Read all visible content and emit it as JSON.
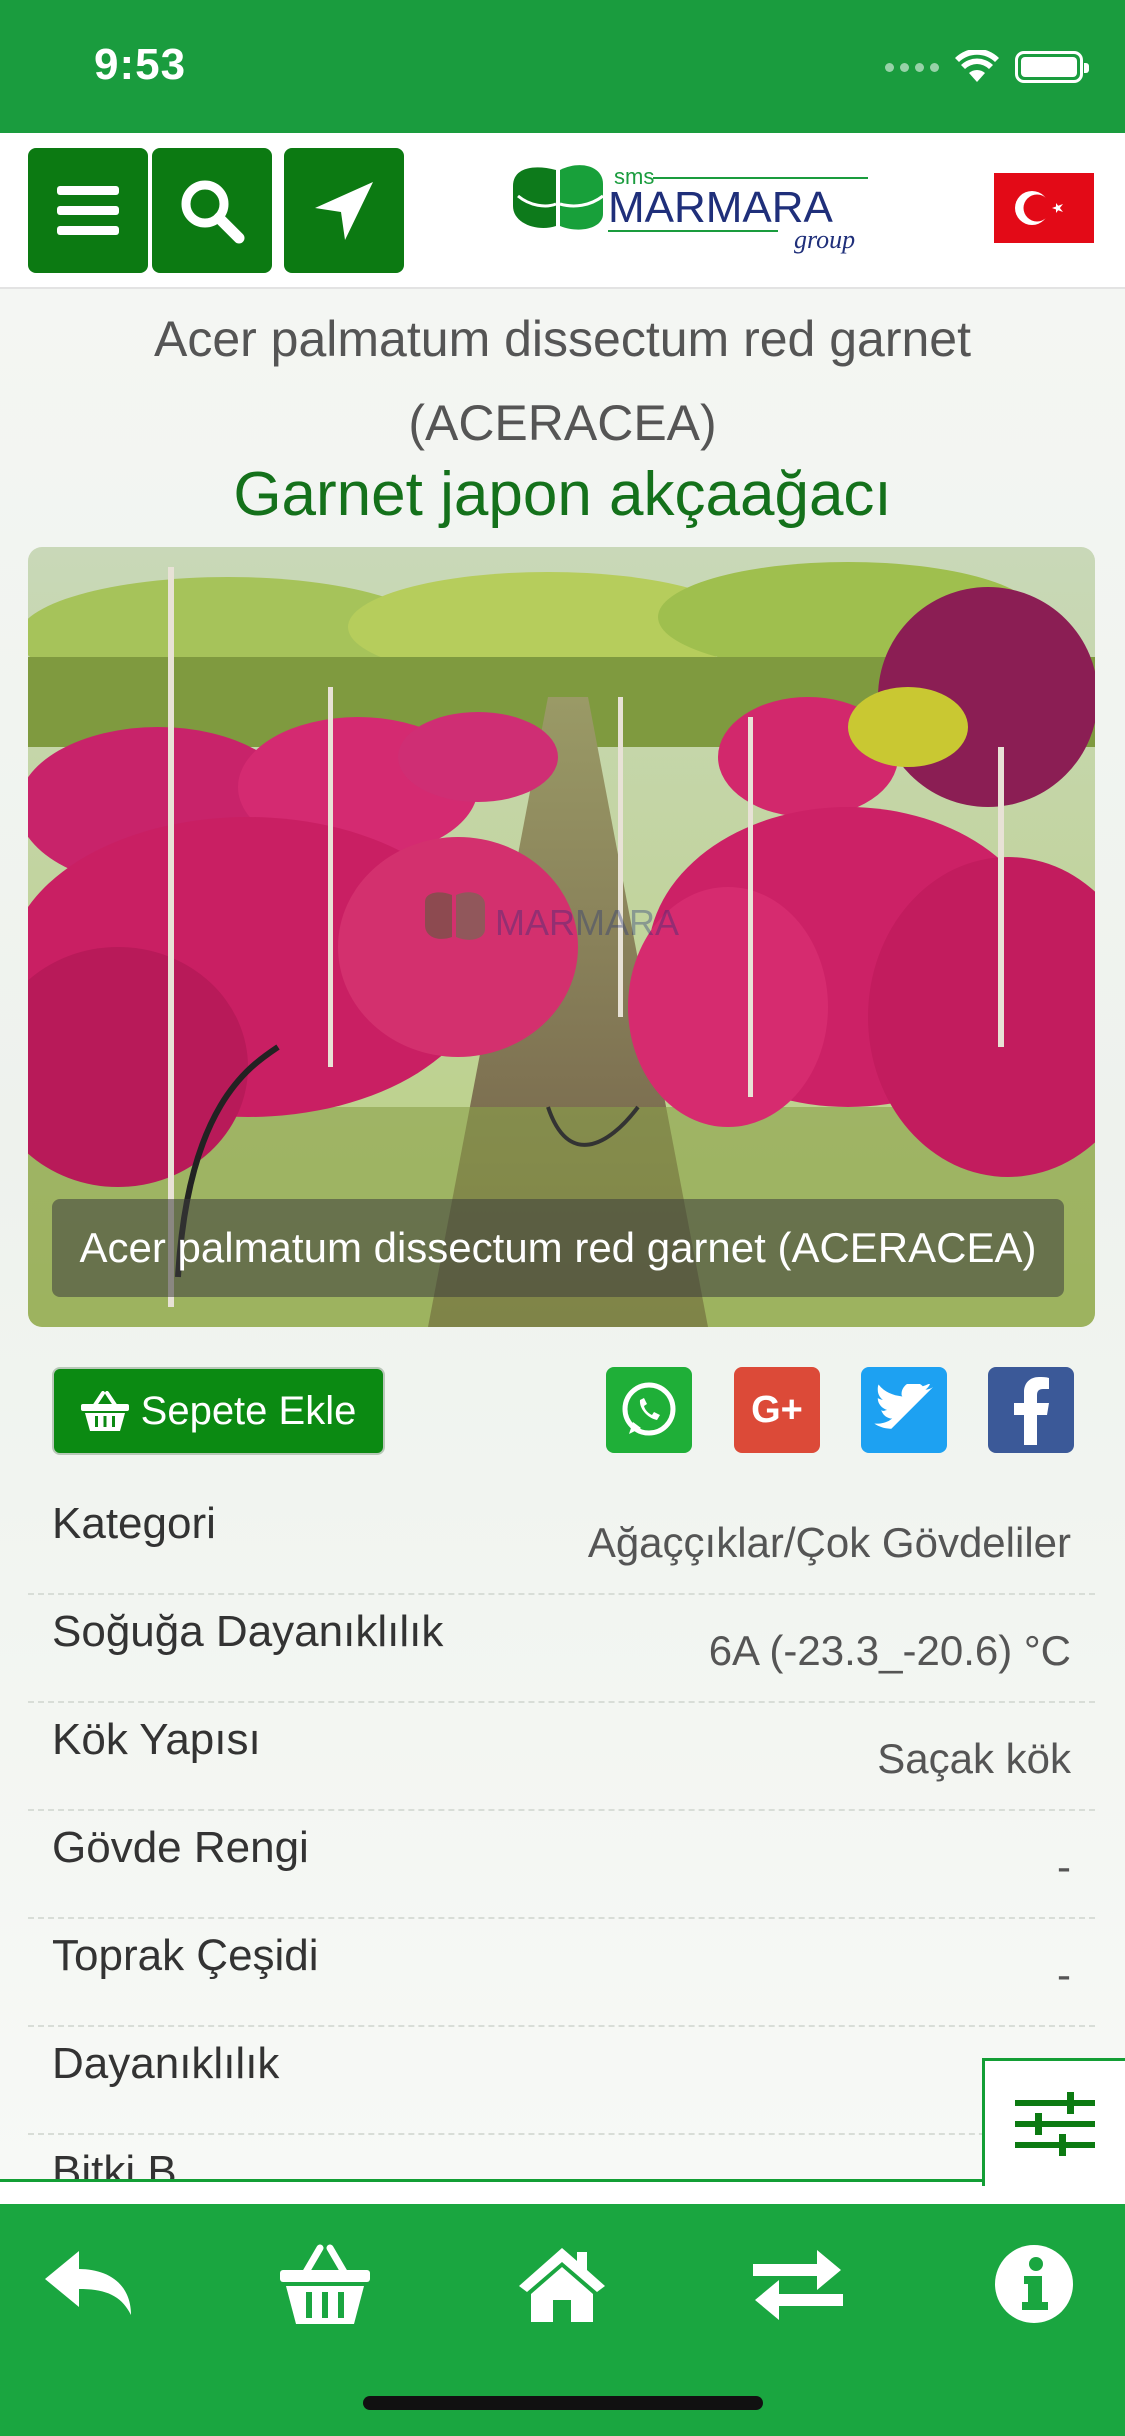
{
  "status_bar": {
    "time": "9:53"
  },
  "header": {
    "logo_small": "sms",
    "logo_main": "MARMARA",
    "logo_sub": "group"
  },
  "product": {
    "latin_name": "Acer palmatum dissectum red garnet (ACERACEA)",
    "common_name": "Garnet japon akçaağacı",
    "photo_caption": "Acer palmatum dissectum red garnet (ACERACEA)",
    "watermark": "MARMARA"
  },
  "actions": {
    "add_to_cart": "Sepete Ekle",
    "share_icons": [
      "whatsapp-icon",
      "google-plus-icon",
      "twitter-icon",
      "facebook-icon"
    ],
    "gplus_text": "G+"
  },
  "specs": [
    {
      "label": "Kategori",
      "value": "Ağaççıklar/Çok Gövdeliler"
    },
    {
      "label": "Soğuğa Dayanıklılık",
      "value": "6A (-23.3_-20.6) °C"
    },
    {
      "label": "Kök Yapısı",
      "value": "Saçak kök"
    },
    {
      "label": "Gövde Rengi",
      "value": "-"
    },
    {
      "label": "Toprak Çeşidi",
      "value": "-"
    },
    {
      "label": "Dayanıklılık",
      "value": ""
    },
    {
      "label": "Bitki B",
      "value": ""
    }
  ],
  "bottom_nav": [
    "back-icon",
    "basket-icon",
    "home-icon",
    "exchange-icon",
    "info-icon"
  ],
  "colors": {
    "brand_green": "#1aa640",
    "dark_green": "#0c7a12",
    "title_green": "#14711b",
    "whatsapp": "#1faf38",
    "google_plus": "#dc4a38",
    "twitter": "#1da1f2",
    "facebook": "#3b5998"
  }
}
